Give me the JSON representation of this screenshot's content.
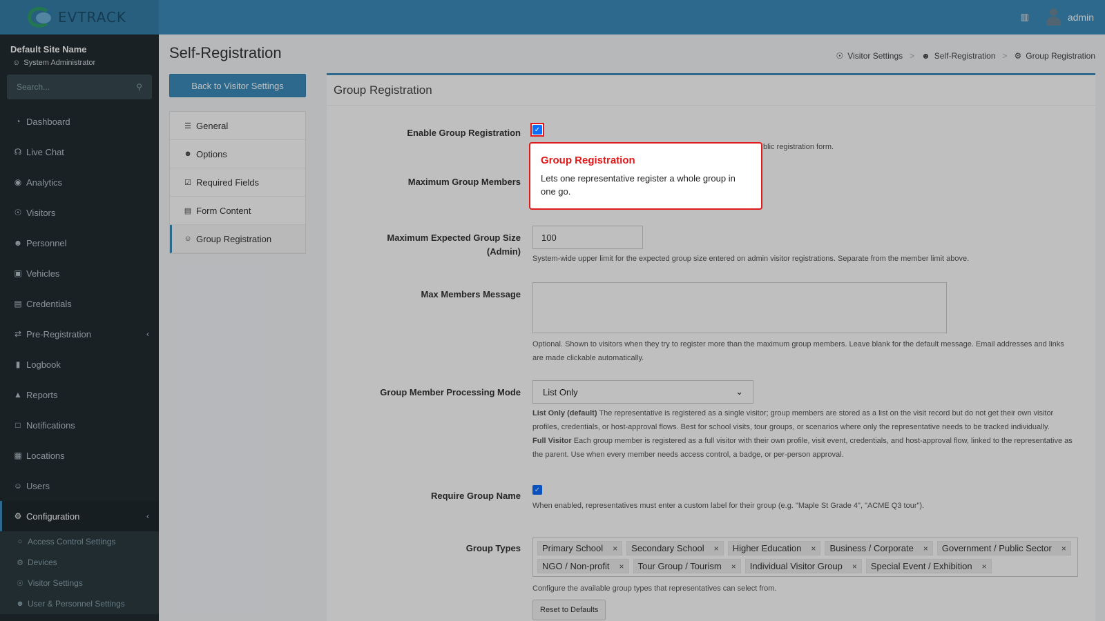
{
  "brand": {
    "name": "EVTRACK"
  },
  "topbar": {
    "user_name": "admin"
  },
  "sidebar": {
    "site_name": "Default Site Name",
    "role": "System Administrator",
    "search_placeholder": "Search...",
    "items": [
      {
        "label": "Dashboard",
        "icon": "dashboard-icon"
      },
      {
        "label": "Live Chat",
        "icon": "headset-icon"
      },
      {
        "label": "Analytics",
        "icon": "analytics-icon"
      },
      {
        "label": "Visitors",
        "icon": "eye-icon"
      },
      {
        "label": "Personnel",
        "icon": "user-gear-icon"
      },
      {
        "label": "Vehicles",
        "icon": "car-icon"
      },
      {
        "label": "Credentials",
        "icon": "id-card-icon"
      },
      {
        "label": "Pre-Registration",
        "icon": "arrows-icon"
      },
      {
        "label": "Logbook",
        "icon": "book-icon"
      },
      {
        "label": "Reports",
        "icon": "chart-icon"
      },
      {
        "label": "Notifications",
        "icon": "bell-icon"
      },
      {
        "label": "Locations",
        "icon": "building-icon"
      },
      {
        "label": "Users",
        "icon": "users-icon"
      },
      {
        "label": "Configuration",
        "icon": "gear-icon"
      }
    ],
    "sub_items": [
      {
        "label": "Access Control Settings"
      },
      {
        "label": "Devices"
      },
      {
        "label": "Visitor Settings"
      },
      {
        "label": "User & Personnel Settings"
      }
    ]
  },
  "page": {
    "title": "Self-Registration",
    "back_button": "Back to Visitor Settings",
    "breadcrumb": [
      "Visitor Settings",
      "Self-Registration",
      "Group Registration"
    ]
  },
  "settings_nav": [
    "General",
    "Options",
    "Required Fields",
    "Form Content",
    "Group Registration"
  ],
  "form": {
    "box_title": "Group Registration",
    "enable_label": "Enable Group Registration",
    "enable_help_tail": "blic registration form.",
    "max_members_label": "Maximum Group Members",
    "max_expected_label_1": "Maximum Expected Group Size",
    "max_expected_label_2": "(Admin)",
    "max_expected_value": "100",
    "max_expected_help": "System-wide upper limit for the expected group size entered on admin visitor registrations. Separate from the member limit above.",
    "max_message_label": "Max Members Message",
    "max_message_help": "Optional. Shown to visitors when they try to register more than the maximum group members. Leave blank for the default message. Email addresses and links are made clickable automatically.",
    "mode_label": "Group Member Processing Mode",
    "mode_value": "List Only",
    "mode_help_1_bold": "List Only (default)",
    "mode_help_1": " The representative is registered as a single visitor; group members are stored as a list on the visit record but do not get their own visitor profiles, credentials, or host-approval flows. Best for school visits, tour groups, or scenarios where only the representative needs to be tracked individually.",
    "mode_help_2_bold": "Full Visitor",
    "mode_help_2": " Each group member is registered as a full visitor with their own profile, visit event, credentials, and host-approval flow, linked to the representative as the parent. Use when every member needs access control, a badge, or per-person approval.",
    "require_name_label": "Require Group Name",
    "require_name_help": "When enabled, representatives must enter a custom label for their group (e.g. \"Maple St Grade 4\", \"ACME Q3 tour\").",
    "types_label": "Group Types",
    "types": [
      "Primary School",
      "Secondary School",
      "Higher Education",
      "Business / Corporate",
      "Government / Public Sector",
      "NGO / Non-profit",
      "Tour Group / Tourism",
      "Individual Visitor Group",
      "Special Event / Exhibition"
    ],
    "types_help": "Configure the available group types that representatives can select from.",
    "reset_button": "Reset to Defaults"
  },
  "tooltip": {
    "title": "Group Registration",
    "body": "Lets one representative register a whole group in one go."
  },
  "colors": {
    "accent": "#3c8dbc",
    "sidebar": "#222d32",
    "highlight": "#e0191a"
  }
}
